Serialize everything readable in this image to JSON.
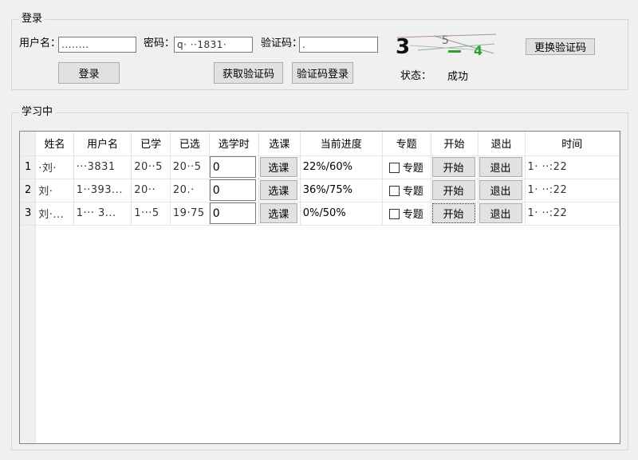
{
  "login": {
    "group_title": "登录",
    "username_label": "用户名：",
    "username_value": "........",
    "password_label": "密码：",
    "password_value": "q·  ··1831·",
    "captcha_label": "验证码：",
    "captcha_value": ".",
    "captcha_image_text": "3 5 4",
    "refresh_captcha_label": "更换验证码",
    "login_button_label": "登录",
    "get_code_label": "获取验证码",
    "code_login_label": "验证码登录",
    "status_label": "状态：",
    "status_value": "成功"
  },
  "study": {
    "group_title": "学习中",
    "columns": [
      "姓名",
      "用户名",
      "已学",
      "已选",
      "选学时",
      "选课",
      "当前进度",
      "专题",
      "开始",
      "退出",
      "时间"
    ],
    "rows": [
      {
        "index": "1",
        "name": "·刘·",
        "username": "···3831",
        "studied": "20··5",
        "selected": "20··5",
        "hours": "0",
        "select_label": "选课",
        "progress": "22%/60%",
        "topic_label": "专题",
        "start_label": "开始",
        "exit_label": "退出",
        "time": "1·  ··:22"
      },
      {
        "index": "2",
        "name": "刘·",
        "username": "1··393...",
        "studied": "20··",
        "selected": "20.·",
        "hours": "0",
        "select_label": "选课",
        "progress": "36%/75%",
        "topic_label": "专题",
        "start_label": "开始",
        "exit_label": "退出",
        "time": "1·  ··:22"
      },
      {
        "index": "3",
        "name": "刘·...",
        "username": "1··· 3...",
        "studied": "1···5",
        "selected": "19·75",
        "hours": "0",
        "select_label": "选课",
        "progress": "0%/50%",
        "topic_label": "专题",
        "start_label": "开始",
        "exit_label": "退出",
        "time": "1·  ··:22"
      }
    ]
  }
}
